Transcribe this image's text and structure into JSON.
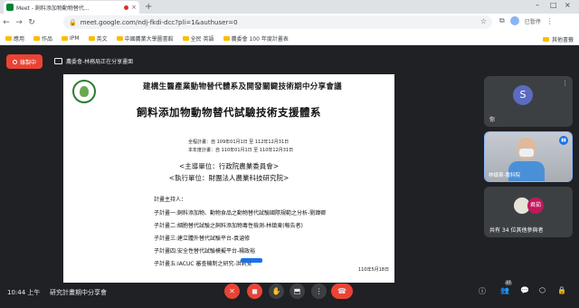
{
  "browser": {
    "tab_title": "Meet - 飼料添加物動物替代...",
    "tab_close": "×",
    "new_tab": "+",
    "window_controls": [
      "–",
      "□",
      "×"
    ],
    "url": "meet.google.com/ndj-fkdi-dcc?pli=1&authuser=0",
    "profile_status": "已暫停",
    "bookmarks": [
      "應用",
      "作品",
      "IPM",
      "英文",
      "中國農業大學圖書館",
      "全民 英語",
      "農委會 100 年度計畫表"
    ],
    "bookmarks_right": "其他書籤"
  },
  "meet": {
    "recording_label": "錄製中",
    "presenter_label": "農委會-林務局正在分享畫面",
    "time": "10:44 上午",
    "meeting_title": "研究計畫期中分享會",
    "participant_badge": "37"
  },
  "slide": {
    "title": "建構生醫產業動物替代體系及開發關鍵技術期中分享會議",
    "subtitle": "飼料添加物動物替代試驗技術支援體系",
    "period_total": "全程計畫：自 109年01月1日 至 112年12月31日",
    "period_year": "本年度計畫：自 110年01月1日 至 110年12月31日",
    "host_agency": "<主導單位：行政院農業委員會>",
    "exec_agency": "<執行單位：財團法人農業科技研究院>",
    "projects_heading": "計畫主持人：",
    "projects": [
      "子計畫一:飼料添加物、動物食品之動物替代試驗國際規範之分析-劉瑋卿",
      "子計畫二:細胞替代試驗之飼料添加物毒性檢測-林鎮東(報告者)",
      "子計畫三:建立體外替代試驗平台-袁滄修",
      "子計畫四:安全性替代試驗模擬平台-楊政裕",
      "子計畫五:IACUC 審查機制之研究-洪莉安"
    ],
    "date": "110年5月18日"
  },
  "tiles": {
    "guest_initial": "S",
    "guest_name": "你",
    "presenter_cam_name": "林鎮東-農科院",
    "others_label": "共有 34 位其他參與者",
    "mini_avatar_2": "君茹",
    "more": "⋮"
  },
  "colors": {
    "recording_red": "#ea4335",
    "hangup_red": "#ea4335",
    "meet_bg": "#202124",
    "tile_bg": "#3c4043",
    "accent_blue": "#1a73e8"
  }
}
